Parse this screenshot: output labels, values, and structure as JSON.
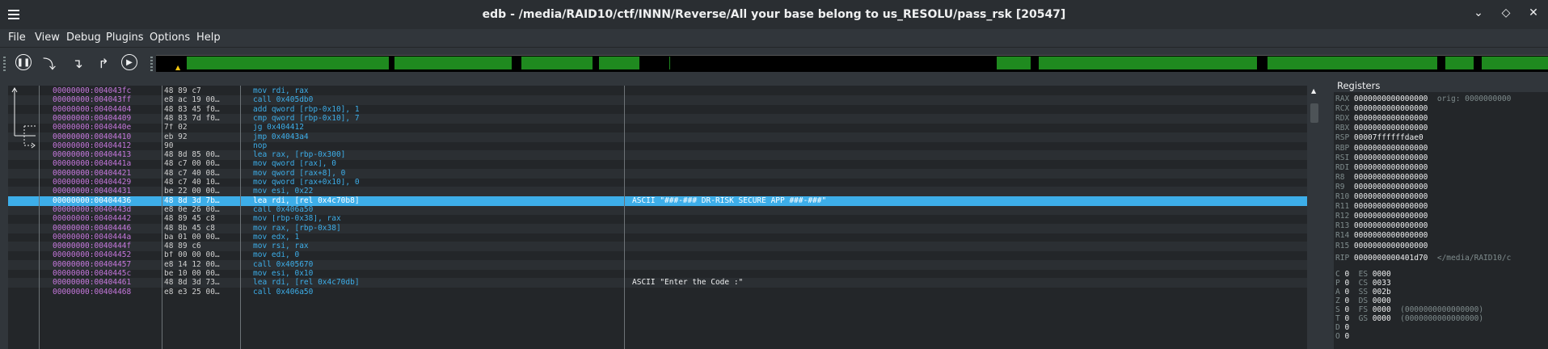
{
  "window": {
    "title": "edb - /media/RAID10/ctf/INNN/Reverse/All your base belong to us_RESOLU/pass_rsk [20547]"
  },
  "menu": [
    "File",
    "View",
    "Debug",
    "Plugins",
    "Options",
    "Help"
  ],
  "toolbar": {
    "icons": [
      "pause-icon",
      "step-into-icon",
      "step-over-icon",
      "step-out-icon",
      "run-icon"
    ]
  },
  "disasm": {
    "rows": [
      {
        "addr": "00000000:004043fc",
        "bytes": "48 89 c7",
        "ins": "mov rdi, rax",
        "comment": ""
      },
      {
        "addr": "00000000:004043ff",
        "bytes": "e8 ac 19 00…",
        "ins": "call 0x405db0",
        "comment": ""
      },
      {
        "addr": "00000000:00404404",
        "bytes": "48 83 45 f0…",
        "ins": "add qword [rbp-0x10], 1",
        "comment": ""
      },
      {
        "addr": "00000000:00404409",
        "bytes": "48 83 7d f0…",
        "ins": "cmp qword [rbp-0x10], 7",
        "comment": ""
      },
      {
        "addr": "00000000:0040440e",
        "bytes": "7f 02",
        "ins": "jg 0x404412",
        "comment": ""
      },
      {
        "addr": "00000000:00404410",
        "bytes": "eb 92",
        "ins": "jmp 0x4043a4",
        "comment": ""
      },
      {
        "addr": "00000000:00404412",
        "bytes": "90",
        "ins": "nop",
        "comment": ""
      },
      {
        "addr": "00000000:00404413",
        "bytes": "48 8d 85 00…",
        "ins": "lea rax, [rbp-0x300]",
        "comment": ""
      },
      {
        "addr": "00000000:0040441a",
        "bytes": "48 c7 00 00…",
        "ins": "mov qword [rax], 0",
        "comment": ""
      },
      {
        "addr": "00000000:00404421",
        "bytes": "48 c7 40 08…",
        "ins": "mov qword [rax+8], 0",
        "comment": ""
      },
      {
        "addr": "00000000:00404429",
        "bytes": "48 c7 40 10…",
        "ins": "mov qword [rax+0x10], 0",
        "comment": ""
      },
      {
        "addr": "00000000:00404431",
        "bytes": "be 22 00 00…",
        "ins": "mov esi, 0x22",
        "comment": ""
      },
      {
        "addr": "00000000:00404436",
        "bytes": "48 8d 3d 7b…",
        "ins": "lea rdi, [rel 0x4c70b8]",
        "comment": "ASCII \"###-### DR-RISK SECURE APP ###-###\""
      },
      {
        "addr": "00000000:0040443d",
        "bytes": "e8 0e 26 00…",
        "ins": "call 0x406a50",
        "comment": ""
      },
      {
        "addr": "00000000:00404442",
        "bytes": "48 89 45 c8",
        "ins": "mov [rbp-0x38], rax",
        "comment": ""
      },
      {
        "addr": "00000000:00404446",
        "bytes": "48 8b 45 c8",
        "ins": "mov rax, [rbp-0x38]",
        "comment": ""
      },
      {
        "addr": "00000000:0040444a",
        "bytes": "ba 01 00 00…",
        "ins": "mov edx, 1",
        "comment": ""
      },
      {
        "addr": "00000000:0040444f",
        "bytes": "48 89 c6",
        "ins": "mov rsi, rax",
        "comment": ""
      },
      {
        "addr": "00000000:00404452",
        "bytes": "bf 00 00 00…",
        "ins": "mov edi, 0",
        "comment": ""
      },
      {
        "addr": "00000000:00404457",
        "bytes": "e8 14 12 00…",
        "ins": "call 0x405670",
        "comment": ""
      },
      {
        "addr": "00000000:0040445c",
        "bytes": "be 10 00 00…",
        "ins": "mov esi, 0x10",
        "comment": ""
      },
      {
        "addr": "00000000:00404461",
        "bytes": "48 8d 3d 73…",
        "ins": "lea rdi, [rel 0x4c70db]",
        "comment": "ASCII \"Enter the Code :\""
      },
      {
        "addr": "00000000:00404468",
        "bytes": "e8 e3 25 00…",
        "ins": "call 0x406a50",
        "comment": ""
      }
    ],
    "selected_index": 12
  },
  "registers": {
    "title": "Registers",
    "gp": [
      {
        "name": "RAX",
        "value": "0000000000000000",
        "extra": "orig: 0000000000"
      },
      {
        "name": "RCX",
        "value": "0000000000000000",
        "extra": ""
      },
      {
        "name": "RDX",
        "value": "0000000000000000",
        "extra": ""
      },
      {
        "name": "RBX",
        "value": "0000000000000000",
        "extra": ""
      },
      {
        "name": "RSP",
        "value": "00007ffffffdae0",
        "extra": ""
      },
      {
        "name": "RBP",
        "value": "0000000000000000",
        "extra": ""
      },
      {
        "name": "RSI",
        "value": "0000000000000000",
        "extra": ""
      },
      {
        "name": "RDI",
        "value": "0000000000000000",
        "extra": ""
      },
      {
        "name": "R8",
        "value": "0000000000000000",
        "extra": ""
      },
      {
        "name": "R9",
        "value": "0000000000000000",
        "extra": ""
      },
      {
        "name": "R10",
        "value": "0000000000000000",
        "extra": ""
      },
      {
        "name": "R11",
        "value": "0000000000000000",
        "extra": ""
      },
      {
        "name": "R12",
        "value": "0000000000000000",
        "extra": ""
      },
      {
        "name": "R13",
        "value": "0000000000000000",
        "extra": ""
      },
      {
        "name": "R14",
        "value": "0000000000000000",
        "extra": ""
      },
      {
        "name": "R15",
        "value": "0000000000000000",
        "extra": ""
      }
    ],
    "rip": {
      "name": "RIP",
      "value": "0000000000401d70",
      "extra": "</media/RAID10/c"
    },
    "flags": [
      {
        "f": "C",
        "v": "0",
        "s": "ES",
        "sv": "0000",
        "x": ""
      },
      {
        "f": "P",
        "v": "0",
        "s": "CS",
        "sv": "0033",
        "x": ""
      },
      {
        "f": "A",
        "v": "0",
        "s": "SS",
        "sv": "002b",
        "x": ""
      },
      {
        "f": "Z",
        "v": "0",
        "s": "DS",
        "sv": "0000",
        "x": ""
      },
      {
        "f": "S",
        "v": "0",
        "s": "FS",
        "sv": "0000",
        "x": "(0000000000000000)"
      },
      {
        "f": "T",
        "v": "0",
        "s": "GS",
        "sv": "0000",
        "x": "(0000000000000000)"
      },
      {
        "f": "D",
        "v": "0",
        "s": "",
        "sv": "",
        "x": ""
      },
      {
        "f": "O",
        "v": "0",
        "s": "",
        "sv": "",
        "x": ""
      }
    ]
  },
  "colors": {
    "selected": "#3daee9",
    "map_green": "#1f8a1f"
  }
}
